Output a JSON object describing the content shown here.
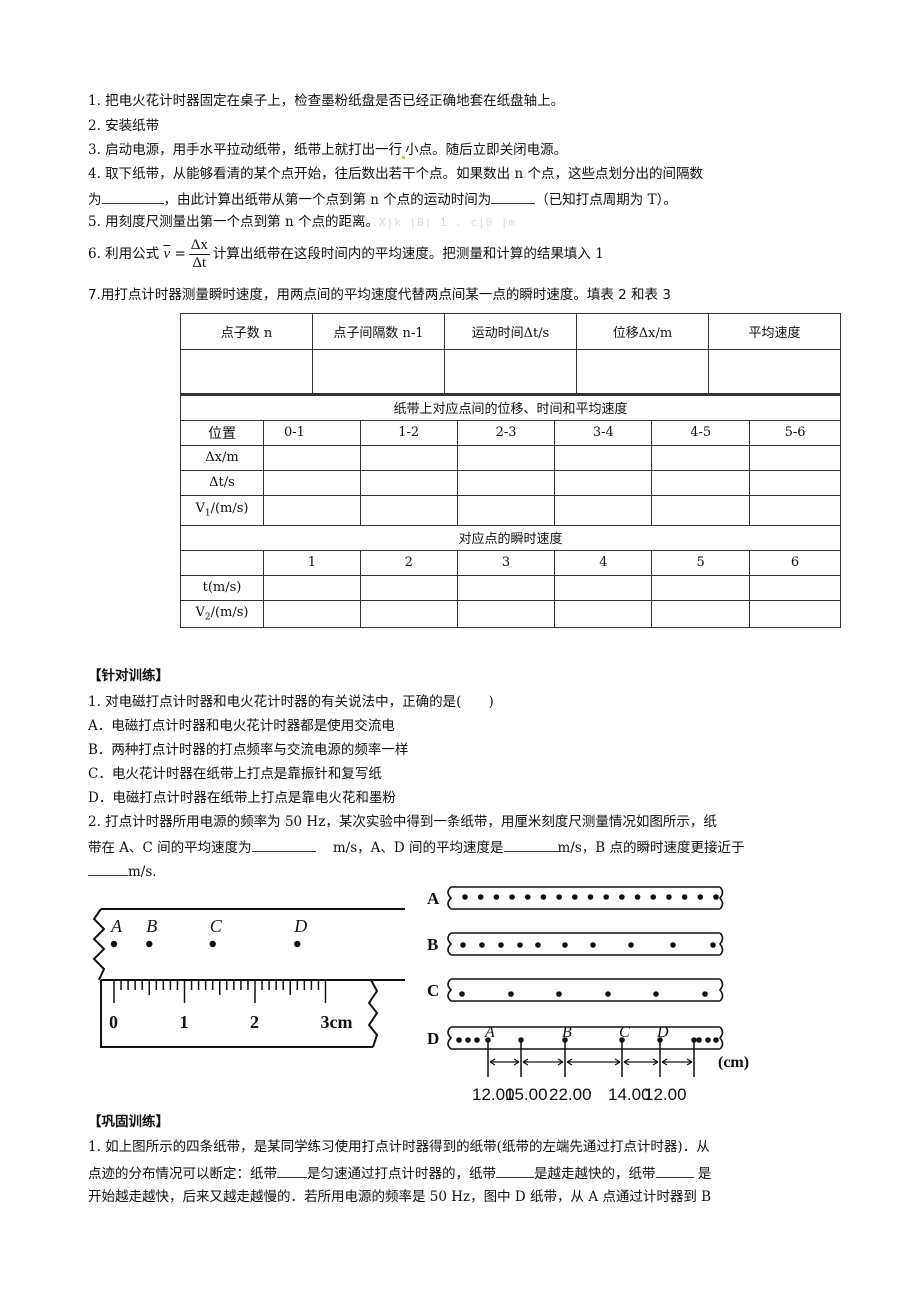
{
  "steps": {
    "s1": "1.  把电火花计时器固定在桌子上，检查墨粉纸盘是否已经正确地套在纸盘轴上。",
    "s2": "2. 安装纸带",
    "s3a": "3. 启动电源，用手水平拉动纸带，纸带上就打出一行",
    "s3b": "小点。随后立即关闭电源。",
    "s4a": "4. 取下纸带，从能够看清的某个点开始，往后数出若干个点。如果数出 n 个点，这些点划分出的间隔数",
    "s4b_pre": "为",
    "s4b_mid": "，由此计算出纸带从第一个点到第 n 个点的运动时间为",
    "s4b_post": "（已知打点周期为 T）。",
    "s5": "5. 用刻度尺测量出第一个点到第 n 个点的距离。",
    "s5_watermark": "X|k   |B| 1 . c|0  |m",
    "s6_pre": "6. 利用公式",
    "s6_v": "v",
    "s6_eq": "=",
    "s6_num": "Δx",
    "s6_den": "Δt",
    "s6_post": "计算出纸带在这段时间内的平均速度。把测量和计算的结果填入 1",
    "s7": "7.用打点计时器测量瞬时速度，用两点间的平均速度代替两点间某一点的瞬时速度。填表 2 和表 3"
  },
  "table1": {
    "headers": [
      "点子数 n",
      "点子间隔数 n-1",
      "运动时间Δt/s",
      "位移Δx/m",
      "平均速度"
    ]
  },
  "table2": {
    "title": "纸带上对应点间的位移、时间和平均速度",
    "position_label": "位置",
    "positions": [
      "0-1",
      "1-2",
      "2-3",
      "3-4",
      "4-5",
      "5-6"
    ],
    "row_labels": [
      "Δx/m",
      "Δt/s",
      "V1/(m/s)"
    ],
    "v1_base": "V",
    "v1_sub": "1",
    "v1_unit": "/(m/s)"
  },
  "table3": {
    "title": "对应点的瞬时速度",
    "points": [
      "1",
      "2",
      "3",
      "4",
      "5",
      "6"
    ],
    "t_label": "t(m/s)",
    "v2_base": "V",
    "v2_sub": "2",
    "v2_unit": "/(m/s)"
  },
  "practice": {
    "heading": "【针对训练】",
    "q1": "1. 对电磁打点计时器和电火花计时器的有关说法中，正确的是(　　)",
    "q1_options": [
      "A．电磁打点计时器和电火花计时器都是使用交流电",
      "B．两种打点计时器的打点频率与交流电源的频率一样",
      "C．电火花计时器在纸带上打点是靠振针和复写纸",
      "D．电磁打点计时器在纸带上打点是靠电火花和墨粉"
    ],
    "q2_line1": "2.  打点计时器所用电源的频率为 50 Hz，某次实验中得到一条纸带，用厘米刻度尺测量情况如图所示，纸",
    "q2_line2_a": "带在 A、C 间的平均速度为",
    "q2_line2_b": "m/s，A、D 间的平均速度是",
    "q2_line2_c": "m/s，B 点的瞬时速度更接近于",
    "q2_line3": "m/s."
  },
  "ruler_figure": {
    "point_labels": [
      "A",
      "B",
      "C",
      "D"
    ],
    "point_positions_cm": [
      0.0,
      0.5,
      1.4,
      2.6
    ],
    "tick_labels": [
      "0",
      "1",
      "2",
      "3cm"
    ]
  },
  "tapes_figure": {
    "tape_labels": [
      "A",
      "B",
      "C",
      "D"
    ],
    "tape_A_dot_count": 17,
    "tape_B_dot_count": 10,
    "tape_C_dot_count": 6,
    "tape_D_point_labels": [
      "A",
      "B",
      "C",
      "D"
    ],
    "tape_D_segments": [
      "12.00",
      "15.00",
      "22.00",
      "14.00",
      "12.00"
    ],
    "unit": "(cm)"
  },
  "consolidation": {
    "heading": "【巩固训练】",
    "q1_line1": "1.  如上图所示的四条纸带，是某同学练习使用打点计时器得到的纸带(纸带的左端先通过打点计时器)．从",
    "q1_line2_a": "点迹的分布情况可以断定：纸带",
    "q1_line2_b": "是匀速通过打点计时器的，纸带",
    "q1_line2_c": "是越走越快的，纸带",
    "q1_line2_d": " 是",
    "q1_line3": "开始越走越快，后来又越走越慢的．若所用电源的频率是 50  Hz，图中 D 纸带，从 A 点通过计时器到 B"
  }
}
